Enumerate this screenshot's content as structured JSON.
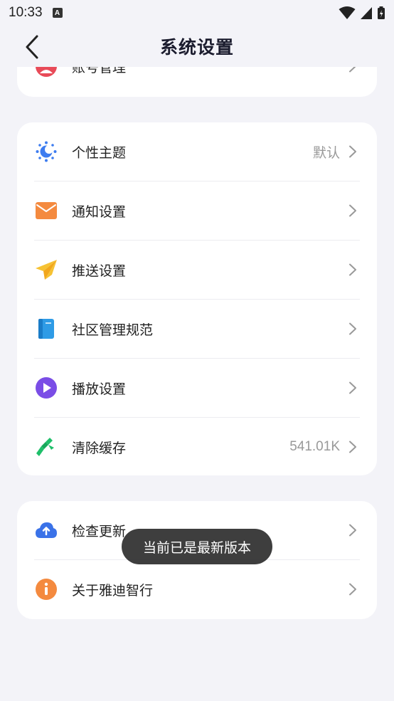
{
  "status_bar": {
    "time": "10:33",
    "notification_badge": "A"
  },
  "header": {
    "title": "系统设置"
  },
  "group1": {
    "items": [
      {
        "label": "账号管理",
        "icon": "account-icon"
      }
    ]
  },
  "group2": {
    "items": [
      {
        "label": "个性主题",
        "value": "默认",
        "icon": "theme-icon"
      },
      {
        "label": "通知设置",
        "icon": "mail-icon"
      },
      {
        "label": "推送设置",
        "icon": "paper-plane-icon"
      },
      {
        "label": "社区管理规范",
        "icon": "book-icon"
      },
      {
        "label": "播放设置",
        "icon": "play-icon"
      },
      {
        "label": "清除缓存",
        "value": "541.01K",
        "icon": "broom-icon"
      }
    ]
  },
  "group3": {
    "items": [
      {
        "label": "检查更新",
        "icon": "cloud-upload-icon"
      },
      {
        "label": "关于雅迪智行",
        "icon": "info-icon"
      }
    ]
  },
  "toast": {
    "text": "当前已是最新版本"
  },
  "colors": {
    "background": "#f3f3f8",
    "card": "#ffffff",
    "theme_icon": "#3d7cf0",
    "mail_icon": "#f48a3f",
    "plane_icon": "#f6c233",
    "book_icon": "#2e9be6",
    "play_icon": "#7a4de6",
    "broom_icon": "#1fbf6a",
    "cloud_icon": "#3a72e8",
    "info_icon": "#f48a3f",
    "account_icon": "#e84a58"
  }
}
